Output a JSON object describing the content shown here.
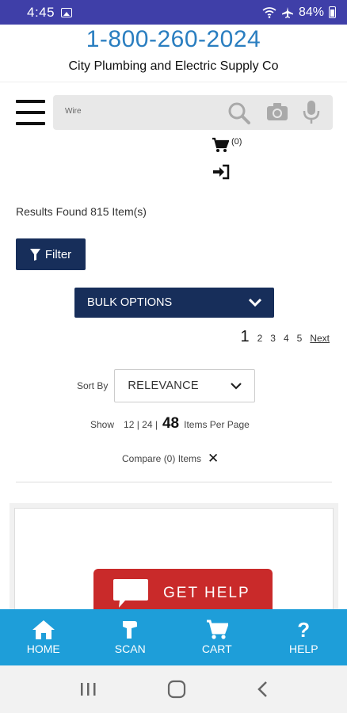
{
  "status_bar": {
    "time": "4:45",
    "battery": "84%"
  },
  "header": {
    "phone": "1-800-260-2024",
    "company": "City Plumbing and Electric Supply Co"
  },
  "search": {
    "placeholder": "Wire"
  },
  "mini_cart": {
    "count": "(0)"
  },
  "results": {
    "text": "Results Found 815 Item(s)"
  },
  "filter": {
    "label": "Filter"
  },
  "bulk": {
    "label": "BULK OPTIONS"
  },
  "pagination": {
    "current": "1",
    "pages": [
      "2",
      "3",
      "4",
      "5"
    ],
    "next": "Next"
  },
  "sort": {
    "label": "Sort By",
    "value": "RELEVANCE"
  },
  "per_page": {
    "label": "Show",
    "options": "12 | 24 |",
    "selected": "48",
    "suffix": "Items Per Page"
  },
  "compare": {
    "label": "Compare (0) Items"
  },
  "promo": {
    "get_help": "GET HELP"
  },
  "bottom_nav": {
    "home": "HOME",
    "scan": "SCAN",
    "cart": "CART",
    "help": "HELP"
  },
  "colors": {
    "status_bar": "#3f3fa8",
    "phone": "#2a7ec0",
    "navy": "#172e5a",
    "nav_blue": "#1e9ed9",
    "help_red": "#c92a2a"
  }
}
